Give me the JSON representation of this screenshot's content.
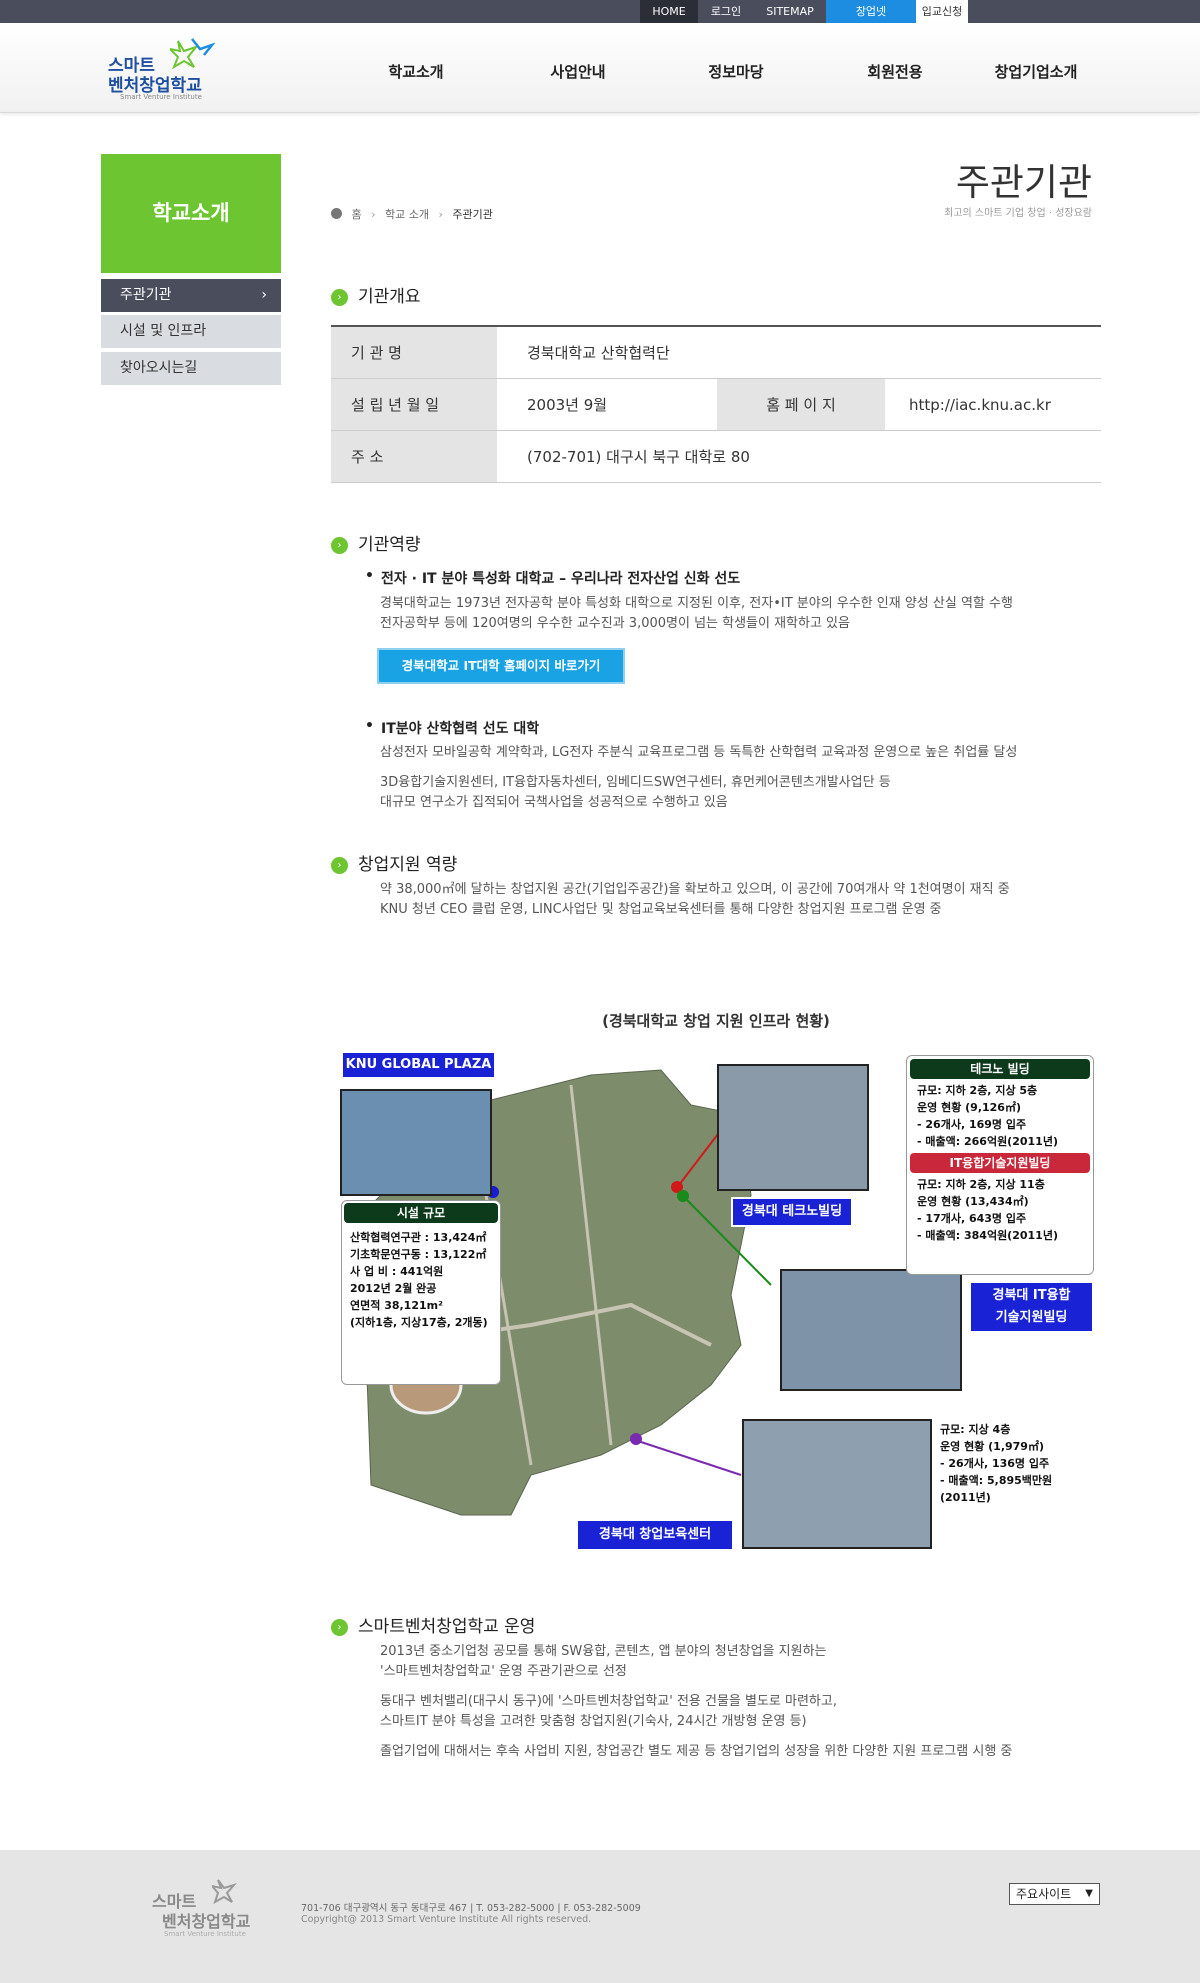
{
  "topbar": {
    "home": "HOME",
    "login": "로그인",
    "sitemap": "SITEMAP",
    "startup_net": "창업넷",
    "apply": "입교신청"
  },
  "logo": {
    "line1": "스마트",
    "line2": "벤처창업학교",
    "english": "Smart Venture Institute"
  },
  "gnb": [
    "학교소개",
    "사업안내",
    "정보마당",
    "회원전용",
    "창업기업소개"
  ],
  "sidebar": {
    "title": "학교소개",
    "items": [
      "주관기관",
      "시설 및 인프라",
      "찾아오시는길"
    ]
  },
  "page": {
    "title": "주관기관",
    "subtitle": "최고의 스마트 기업 창업 · 성장요람"
  },
  "breadcrumb": {
    "home": "홈",
    "level1": "학교 소개",
    "current": "주관기관"
  },
  "overview": {
    "heading": "기관개요",
    "org_label": "기 관 명",
    "org_value": "경북대학교 산학협력단",
    "founded_label": "설 립 년 월 일",
    "founded_value": "2003년 9월",
    "homepage_label": "홈 페 이 지",
    "homepage_value": "http://iac.knu.ac.kr",
    "address_label": "주 소",
    "address_value": "(702-701) 대구시 북구 대학로 80"
  },
  "capability": {
    "heading": "기관역량",
    "sub1": "전자 · IT 분야 특성화 대학교 – 우리나라 전자산업 신화 선도",
    "text1a": "경북대학교는 1973년 전자공학 분야 특성화 대학으로 지정된 이후, 전자•IT 분야의 우수한 인재 양성 산실 역할 수행",
    "text1b": "전자공학부 등에 120여명의 우수한 교수진과 3,000명이 넘는 학생들이 재학하고 있음",
    "button": "경북대학교 IT대학 홈페이지 바로가기",
    "sub2": "IT분야 산학협력 선도 대학",
    "text2a": "삼성전자 모바일공학 계약학과, LG전자 주분식 교육프로그램 등 독특한 산학협력 교육과정 운영으로 높은 취업률 달성",
    "text2b": "3D융합기술지원센터, IT융합자동차센터, 임베디드SW연구센터, 휴먼케어콘텐츠개발사업단 등",
    "text2c": "대규모 연구소가 집적되어 국책사업을 성공적으로 수행하고 있음"
  },
  "startup": {
    "heading": "창업지원 역량",
    "text1": "약 38,000㎡에 달하는 창업지원 공간(기업입주공간)을 확보하고 있으며, 이 공간에 70여개사 약 1천여명이 재직 중",
    "text2": "KNU 청년 CEO 클럽 운영, LINC사업단 및 창업교육보육센터를 통해 다양한 창업지원 프로그램 운영 중"
  },
  "map": {
    "caption": "(경북대학교 창업 지원 인프라 현황)",
    "global_plaza": "KNU GLOBAL PLAZA",
    "facility_title": "시설 규모",
    "facility_lines": [
      "산학협력연구관 : 13,424㎡",
      "기초학문연구동 : 13,122㎡",
      "사 업 비 : 441억원",
      "2012년 2월 완공",
      "연면적 38,121m²",
      "(지하1층, 지상17층, 2개동)"
    ],
    "techno_title": "테크노 빌딩",
    "techno_lines": [
      "규모: 지하 2층, 지상 5층",
      "운영 현황 (9,126㎡)",
      "- 26개사, 169명 입주",
      "- 매출액: 266억원(2011년)"
    ],
    "itfusion_title": "IT융합기술지원빌딩",
    "itfusion_lines": [
      "규모: 지하 2층, 지상 11층",
      "운영 현황 (13,434㎡)",
      "- 17개사, 643명 입주",
      "- 매출액: 384억원(2011년)"
    ],
    "label_techno": "경북대 테크노빌딩",
    "label_itfusion_1": "경북대 IT융합",
    "label_itfusion_2": "기술지원빌딩",
    "incubator_lines": [
      "규모: 지상 4층",
      "운영 현황 (1,979㎡)",
      "- 26개사, 136명 입주",
      "- 매출액: 5,895백만원",
      "(2011년)"
    ],
    "label_incubator": "경북대 창업보육센터"
  },
  "operation": {
    "heading": "스마트벤처창업학교 운영",
    "p1a": "2013년 중소기업청 공모를 통해 SW융합, 콘텐츠, 앱 분야의 청년창업을 지원하는",
    "p1b": "'스마트벤처창업학교' 운영 주관기관으로 선정",
    "p2a": "동대구 벤처밸리(대구시 동구)에 '스마트벤처창업학교' 전용 건물을 별도로 마련하고,",
    "p2b": "스마트IT 분야 특성을 고려한 맞춤형 창업지원(기숙사, 24시간 개방형 운영 등)",
    "p3": "졸업기업에 대해서는 후속 사업비 지원, 창업공간 별도 제공 등 창업기업의 성장을 위한 다양한 지원 프로그램 시행 중"
  },
  "footer": {
    "logo1": "스마트",
    "logo2": "벤처창업학교",
    "logo_en": "Smart Venture Institute",
    "address": "701-706 대구광역시 동구 동대구로 467 | T. 053-282-5000 | F. 053-282-5009",
    "copyright": "Copyright@ 2013 Smart Venture Institute All rights reserved.",
    "select": "주요사이트"
  },
  "colors": {
    "accent_green": "#6dc531",
    "nav_dark": "#4a4d5c",
    "button_blue": "#19a3e5"
  }
}
